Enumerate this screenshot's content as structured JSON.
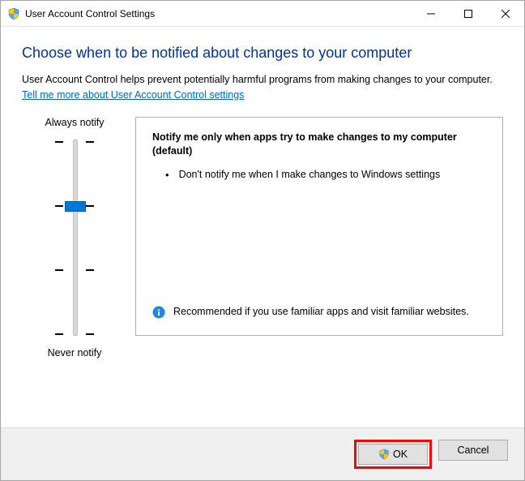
{
  "window": {
    "title": "User Account Control Settings"
  },
  "content": {
    "heading": "Choose when to be notified about changes to your computer",
    "description": "User Account Control helps prevent potentially harmful programs from making changes to your computer.",
    "link": "Tell me more about User Account Control settings"
  },
  "slider": {
    "top_label": "Always notify",
    "bottom_label": "Never notify",
    "levels": 4,
    "selected_index": 1
  },
  "detail": {
    "title": "Notify me only when apps try to make changes to my computer (default)",
    "bullet": "Don't notify me when I make changes to Windows settings",
    "recommend": "Recommended if you use familiar apps and visit familiar websites."
  },
  "buttons": {
    "ok": "OK",
    "cancel": "Cancel"
  }
}
